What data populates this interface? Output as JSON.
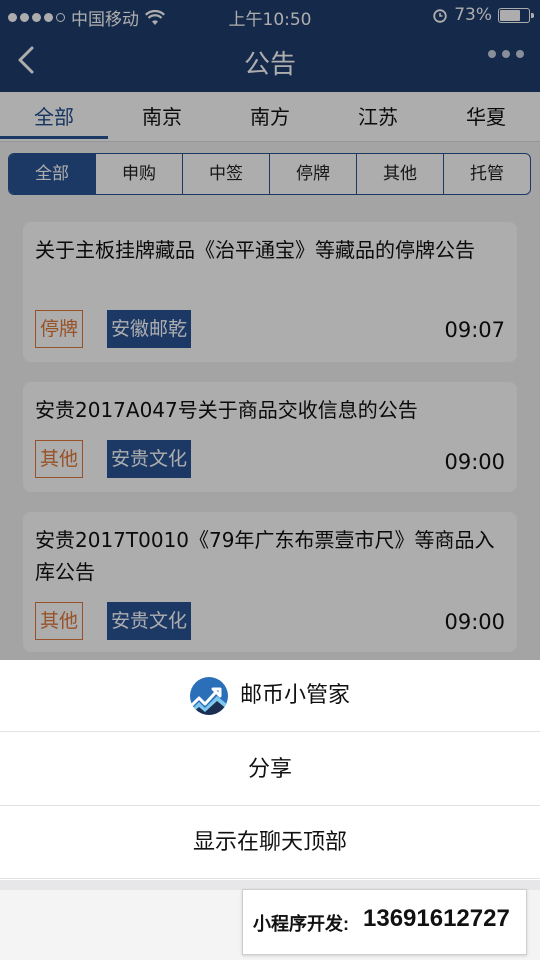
{
  "status_bar": {
    "carrier": "中国移动",
    "time": "上午10:50",
    "battery": "73%",
    "battery_level": 0.73
  },
  "nav": {
    "title": "公告"
  },
  "region_tabs": [
    "全部",
    "南京",
    "南方",
    "江苏",
    "华夏"
  ],
  "type_tabs": [
    "全部",
    "申购",
    "中签",
    "停牌",
    "其他",
    "托管"
  ],
  "cards": [
    {
      "title": "关于主板挂牌藏品《治平通宝》等藏品的停牌公告",
      "status": "停牌",
      "org": "安徽邮乾",
      "time": "09:07"
    },
    {
      "title": "安贵2017A047号关于商品交收信息的公告",
      "status": "其他",
      "org": "安贵文化",
      "time": "09:00"
    },
    {
      "title": "安贵2017T0010《79年广东布票壹市尺》等商品入库公告",
      "status": "其他",
      "org": "安贵文化",
      "time": "09:00"
    }
  ],
  "sheet": {
    "app_name": "邮币小管家",
    "share": "分享",
    "pin": "显示在聊天顶部"
  },
  "promo": {
    "label": "小程序开发:",
    "phone": "13691612727"
  },
  "colors": {
    "brand": "#1f3d6e",
    "accent": "#2a5597",
    "status_tag": "#e07a3a"
  }
}
